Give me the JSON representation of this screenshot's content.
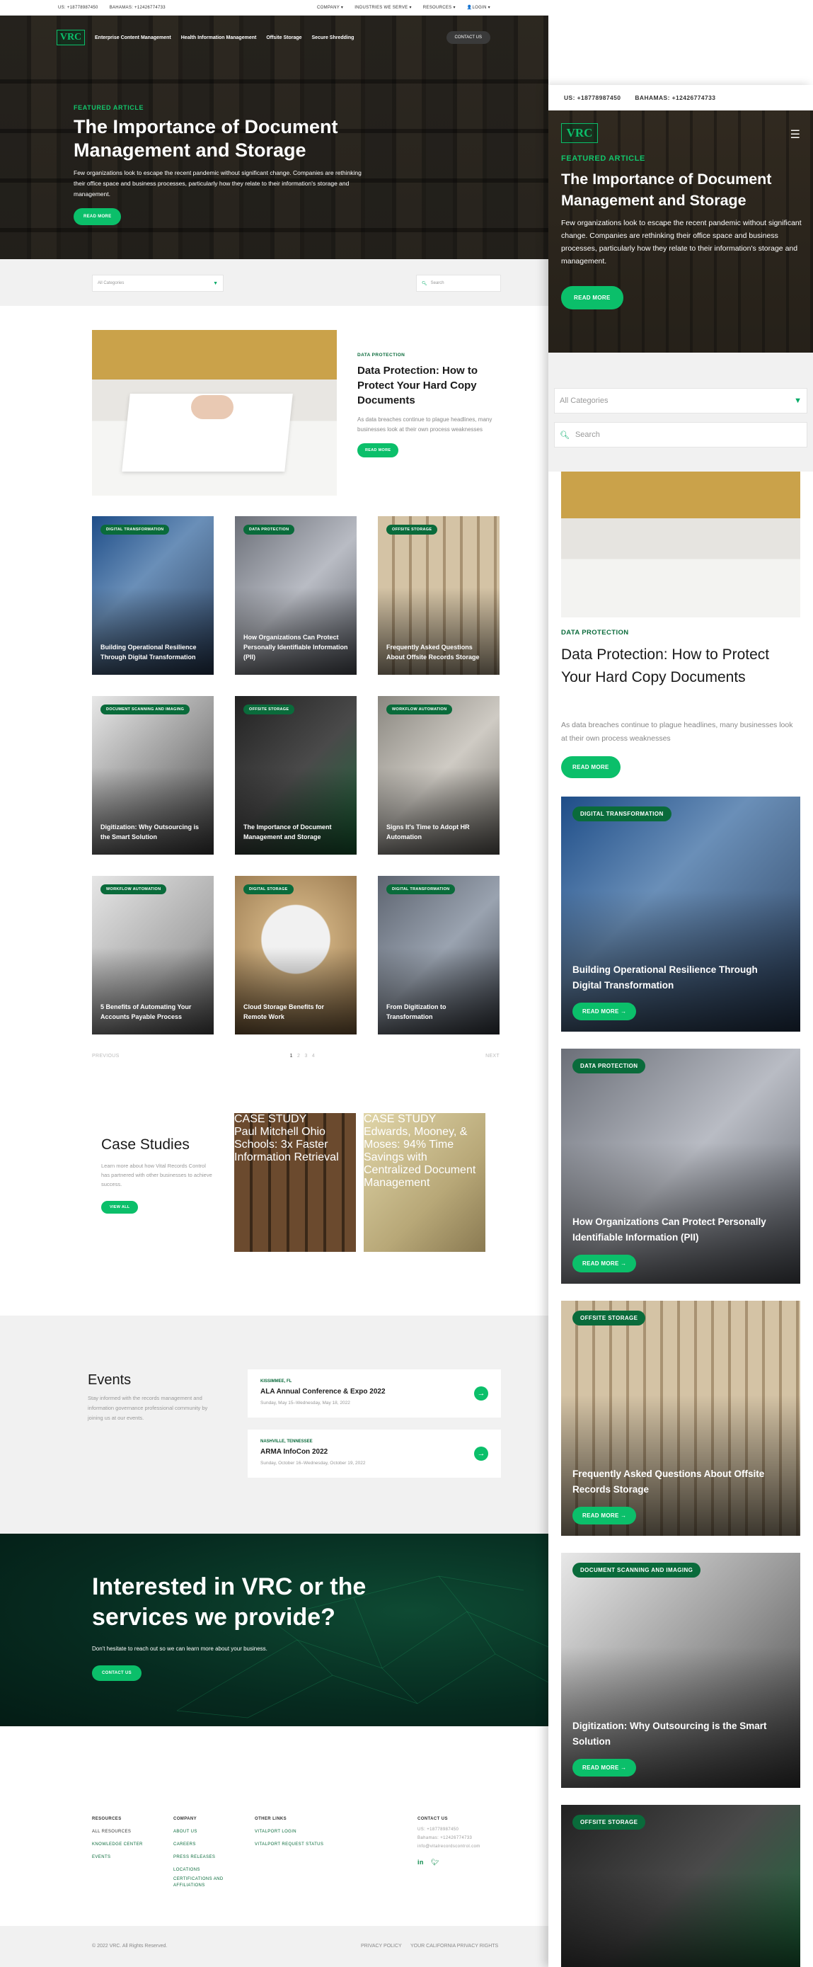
{
  "topbar": {
    "phone_us": "US: +18778987450",
    "phone_bahamas": "BAHAMAS: +12426774733",
    "menu": [
      "COMPANY ▾",
      "INDUSTRIES WE SERVE ▾",
      "RESOURCES ▾",
      "LOGIN ▾"
    ]
  },
  "nav": {
    "logo": "VRC",
    "links": [
      "Enterprise Content Management",
      "Health Information Management",
      "Offsite Storage",
      "Secure Shredding"
    ],
    "contact": "CONTACT US"
  },
  "hero": {
    "kicker": "FEATURED ARTICLE",
    "title": "The Importance of Document Management and Storage",
    "text": "Few organizations look to escape the recent pandemic without significant change. Companies are rethinking their office space and business processes, particularly how they relate to their information's storage and management.",
    "button": "READ MORE"
  },
  "filter": {
    "category_placeholder": "All Categories",
    "search_placeholder": "Search"
  },
  "featured": {
    "kicker": "DATA PROTECTION",
    "title": "Data Protection: How to Protect Your Hard Copy Documents",
    "text": "As data breaches continue to plague headlines, many businesses look at their own process weaknesses",
    "button": "READ MORE"
  },
  "articles": [
    {
      "tag": "DIGITAL TRANSFORMATION",
      "title": "Building Operational Resilience Through Digital Transformation"
    },
    {
      "tag": "DATA PROTECTION",
      "title": "How Organizations Can Protect Personally Identifiable Information (PII)"
    },
    {
      "tag": "OFFSITE STORAGE",
      "title": "Frequently Asked Questions About Offsite Records Storage"
    },
    {
      "tag": "DOCUMENT SCANNING AND IMAGING",
      "title": "Digitization: Why Outsourcing is the Smart Solution"
    },
    {
      "tag": "OFFSITE STORAGE",
      "title": "The Importance of Document Management and Storage"
    },
    {
      "tag": "WORKFLOW AUTOMATION",
      "title": "Signs It's Time to Adopt HR Automation"
    },
    {
      "tag": "WORKFLOW AUTOMATION",
      "title": "5 Benefits of Automating Your Accounts Payable Process"
    },
    {
      "tag": "DIGITAL STORAGE",
      "title": "Cloud Storage Benefits for Remote Work"
    },
    {
      "tag": "DIGITAL TRANSFORMATION",
      "title": "From Digitization to Transformation"
    }
  ],
  "pager": {
    "prev": "PREVIOUS",
    "pages": [
      "1",
      "2",
      "3",
      "4"
    ],
    "next": "NEXT"
  },
  "cases": {
    "title": "Case Studies",
    "text": "Learn more about how Vital Records Control has partnered with other businesses to achieve success.",
    "button": "VIEW ALL",
    "items": [
      {
        "tag": "CASE STUDY",
        "title": "Paul Mitchell Ohio Schools: 3x Faster Information Retrieval"
      },
      {
        "tag": "CASE STUDY",
        "title": "Edwards, Mooney, & Moses: 94% Time Savings with Centralized Document Management"
      }
    ]
  },
  "events": {
    "title": "Events",
    "text": "Stay informed with the records management and information governance professional community by joining us at our events.",
    "items": [
      {
        "location": "KISSIMMEE, FL",
        "name": "ALA Annual Conference & Expo 2022",
        "date": "Sunday, May 15–Wednesday, May 18, 2022"
      },
      {
        "location": "NASHVILLE, TENNESSEE",
        "name": "ARMA InfoCon 2022",
        "date": "Sunday, October 16–Wednesday, October 19, 2022"
      }
    ]
  },
  "cta": {
    "title": "Interested in VRC or the services we provide?",
    "text": "Don't hesitate to reach out so we can learn more about your business.",
    "button": "CONTACT US"
  },
  "footer": {
    "resources": {
      "heading": "RESOURCES",
      "links": [
        "ALL RESOURCES",
        "KNOWLEDGE CENTER",
        "EVENTS"
      ]
    },
    "company": {
      "heading": "COMPANY",
      "links": [
        "ABOUT US",
        "CAREERS",
        "PRESS RELEASES",
        "LOCATIONS",
        "CERTIFICATIONS AND AFFILIATIONS"
      ]
    },
    "other": {
      "heading": "OTHER LINKS",
      "links": [
        "VITALPORT LOGIN",
        "VITALPORT REQUEST STATUS"
      ]
    },
    "contact": {
      "heading": "CONTACT US",
      "lines": [
        "US: +18778987450",
        "Bahamas: +12426774733",
        "info@vitalrecordscontrol.com"
      ]
    },
    "copyright": "© 2022 VRC. All Rights Reserved.",
    "legal": [
      "PRIVACY POLICY",
      "YOUR CALIFORNIA PRIVACY RIGHTS"
    ]
  },
  "mobile": {
    "phone_us": "US: +18778987450",
    "phone_bahamas": "BAHAMAS: +12426774733",
    "read_more": "READ MORE →",
    "extra_tag": "OFFSITE STORAGE"
  },
  "colors": {
    "accent": "#0bbf6a",
    "tag_bg": "#0a6b3b",
    "cta_bg": "#062a1f",
    "band_bg": "#f1f1f1"
  }
}
